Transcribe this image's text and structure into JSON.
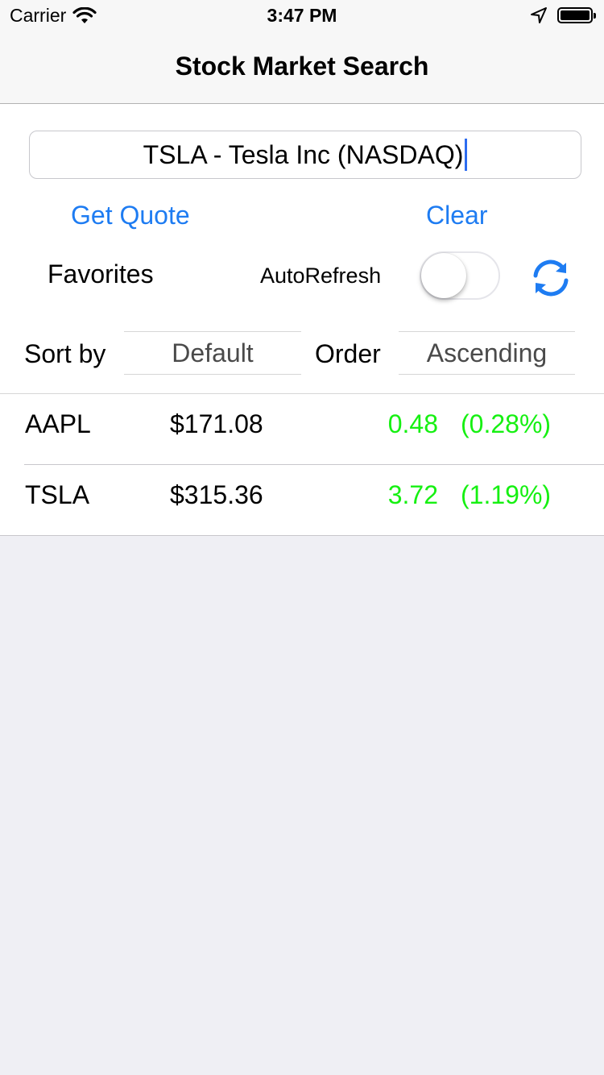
{
  "status_bar": {
    "carrier": "Carrier",
    "time": "3:47 PM"
  },
  "nav": {
    "title": "Stock Market Search"
  },
  "search": {
    "value": "TSLA - Tesla Inc (NASDAQ)"
  },
  "actions": {
    "get_quote": "Get Quote",
    "clear": "Clear"
  },
  "favorites": {
    "label": "Favorites",
    "autorefresh_label": "AutoRefresh",
    "autorefresh_on": false
  },
  "sorting": {
    "sort_by_label": "Sort by",
    "sort_by_value": "Default",
    "order_label": "Order",
    "order_value": "Ascending"
  },
  "stocks": [
    {
      "symbol": "AAPL",
      "price": "$171.08",
      "change": "0.48",
      "change_percent": "(0.28%)"
    },
    {
      "symbol": "TSLA",
      "price": "$315.36",
      "change": "3.72",
      "change_percent": "(1.19%)"
    }
  ],
  "colors": {
    "accent": "#1e7cf2",
    "positive": "#16f012",
    "background": "#efeff4"
  },
  "icons": {
    "wifi": "wifi-icon",
    "location": "location-arrow-icon",
    "battery": "battery-icon",
    "refresh": "refresh-icon"
  }
}
